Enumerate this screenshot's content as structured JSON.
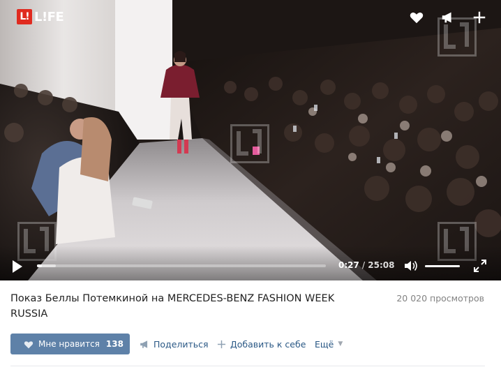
{
  "player": {
    "logo_mark": "L!",
    "logo_text": "L!FE",
    "top_icons": [
      "heart-icon",
      "megaphone-icon",
      "plus-icon"
    ],
    "current_time": "0:27",
    "time_separator": "/",
    "duration": "25:08",
    "progress_fraction": 0.018,
    "buffered_fraction": 0.065,
    "volume_fraction": 1.0
  },
  "video": {
    "title": "Показ Беллы Потемкиной на MERCEDES-BENZ FASHION WEEK RUSSIA",
    "views": "20 020 просмотров"
  },
  "actions": {
    "like_label": "Мне нравится",
    "like_count": "138",
    "share_label": "Поделиться",
    "add_label": "Добавить к себе",
    "more_label": "Ещё"
  },
  "colors": {
    "like_button": "#5e81a8",
    "link": "#2a5885",
    "logo_red": "#e02a1f"
  }
}
